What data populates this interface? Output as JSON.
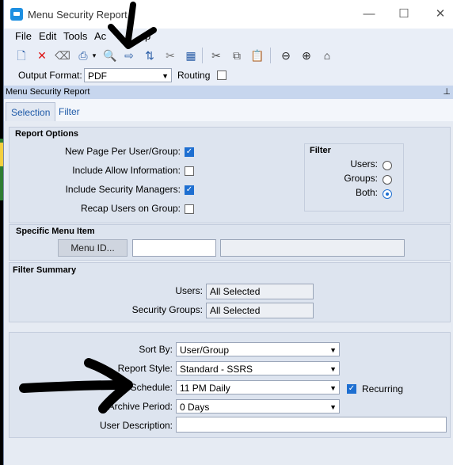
{
  "window": {
    "title": "Menu Security Report",
    "minimize": "—",
    "maximize": "☐",
    "close": "✕"
  },
  "menubar": {
    "items": [
      "File",
      "Edit",
      "Tools",
      "Ac",
      "p"
    ]
  },
  "output": {
    "label": "Output Format:",
    "value": "PDF",
    "routing_label": "Routing"
  },
  "panel": {
    "header": "Menu Security Report",
    "pin_icon": "pin-icon"
  },
  "tabs": {
    "selection": "Selection",
    "filter": "Filter"
  },
  "report_options": {
    "title": "Report Options",
    "new_page": "New Page Per User/Group:",
    "include_allow": "Include Allow Information:",
    "include_security_managers": "Include Security Managers:",
    "recap_users": "Recap Users on Group:",
    "checked": {
      "new_page": true,
      "include_allow": false,
      "include_security_managers": true,
      "recap_users": false
    }
  },
  "filter_box": {
    "title": "Filter",
    "users": "Users:",
    "groups": "Groups:",
    "both": "Both:",
    "selected": "both"
  },
  "specific_menu": {
    "title": "Specific Menu Item",
    "button": "Menu ID...",
    "input_value": "",
    "description_value": ""
  },
  "filter_summary": {
    "title": "Filter Summary",
    "users_label": "Users:",
    "users_value": "All Selected",
    "groups_label": "Security Groups:",
    "groups_value": "All Selected"
  },
  "bottom": {
    "sort_by_label": "Sort By:",
    "sort_by_value": "User/Group",
    "report_style_label": "Report Style:",
    "report_style_value": "Standard - SSRS",
    "schedule_label": "Schedule:",
    "schedule_value": "11 PM Daily",
    "recurring_label": "Recurring",
    "archive_label": "Archive Period:",
    "archive_value": "0 Days",
    "user_description_label": "User Description:",
    "user_description_value": ""
  },
  "colors": {
    "accent": "#1e6fd1",
    "panel_header": "#c7d6ee",
    "window_bg": "#f3f6fb",
    "annotation_arrow": "#000000"
  }
}
